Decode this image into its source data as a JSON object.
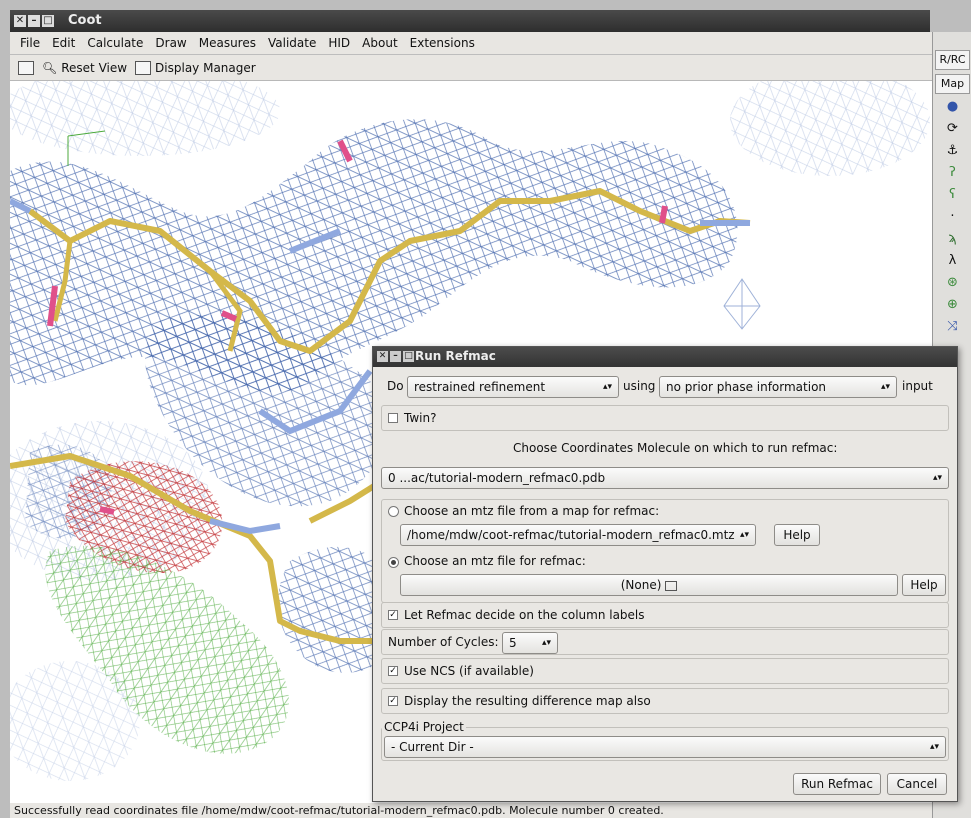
{
  "window": {
    "title": "Coot"
  },
  "menu": [
    "File",
    "Edit",
    "Calculate",
    "Draw",
    "Measures",
    "Validate",
    "HID",
    "About",
    "Extensions"
  ],
  "toolbar": {
    "reset_view": "Reset View",
    "display_manager": "Display Manager"
  },
  "right_panel": {
    "button1": "R/RC",
    "button2": "Map"
  },
  "status": "Successfully read coordinates file /home/mdw/coot-refmac/tutorial-modern_refmac0.pdb.  Molecule number 0 created.",
  "dialog": {
    "title": "Run Refmac",
    "do_label": "Do",
    "refinement_type": "restrained refinement",
    "using_label": "using",
    "phase_option": "no prior phase information",
    "input_label": "input",
    "twin_label": "Twin?",
    "choose_coords_label": "Choose Coordinates Molecule on which to run refmac:",
    "coords_molecule": "0 ...ac/tutorial-modern_refmac0.pdb",
    "mtz_from_map_label": "Choose an mtz file from a map for refmac:",
    "mtz_from_map_value": "/home/mdw/coot-refmac/tutorial-modern_refmac0.mtz",
    "help_label": "Help",
    "mtz_file_label": "Choose an mtz file for refmac:",
    "mtz_file_value": "(None)",
    "let_refmac_label": "Let Refmac decide on the column labels",
    "cycles_label": "Number of Cycles:",
    "cycles_value": "5",
    "use_ncs_label": "Use NCS (if available)",
    "display_diff_label": "Display the resulting difference map also",
    "ccp4i_label": "CCP4i Project",
    "ccp4i_value": "- Current Dir -",
    "run_button": "Run Refmac",
    "cancel_button": "Cancel"
  },
  "colors": {
    "density_blue": "#3c5fa8",
    "density_red": "#c0282c",
    "density_green": "#4caa3c",
    "backbone_yellow": "#d4b84a",
    "bond_blue": "#8fa8df",
    "oxygen_pink": "#e0508a"
  }
}
